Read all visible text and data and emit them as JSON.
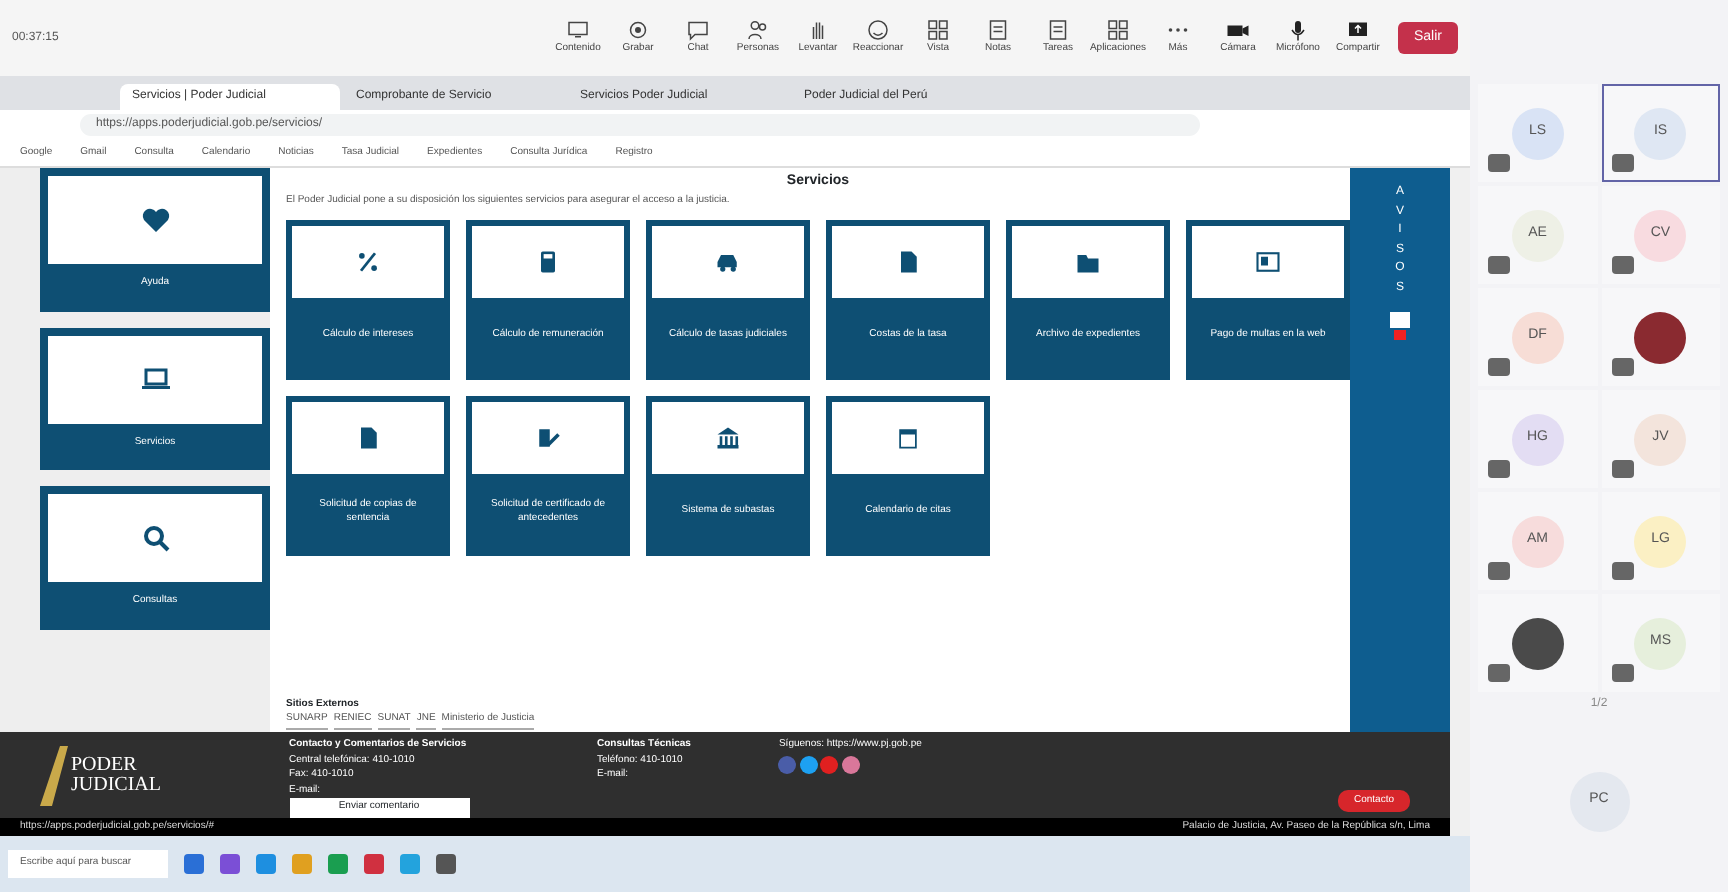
{
  "meeting_bar": {
    "timer": "00:37:15",
    "tools": [
      {
        "label": "Contenido"
      },
      {
        "label": "Grabar"
      },
      {
        "label": "Chat"
      },
      {
        "label": "Personas"
      },
      {
        "label": "Levantar"
      },
      {
        "label": "Reaccionar"
      },
      {
        "label": "Vista"
      },
      {
        "label": "Notas"
      },
      {
        "label": "Tareas"
      },
      {
        "label": "Aplicaciones"
      },
      {
        "label": "Más"
      },
      {
        "label": "Cámara"
      },
      {
        "label": "Micrófono"
      },
      {
        "label": "Compartir"
      }
    ],
    "leave_button": "Salir"
  },
  "browser": {
    "tabs": [
      {
        "title": "Servicios | Poder Judicial",
        "selected": true
      },
      {
        "title": "Comprobante de Servicio",
        "selected": false
      },
      {
        "title": "Servicios Poder Judicial",
        "selected": false
      },
      {
        "title": "Poder Judicial del Perú",
        "selected": false
      }
    ],
    "address": "https://apps.poderjudicial.gob.pe/servicios/",
    "bookmarks": [
      "Google",
      "Gmail",
      "Consulta",
      "Calendario",
      "Noticias",
      "Tasa Judicial",
      "Expedientes",
      "Consulta Jurídica",
      "Registro"
    ]
  },
  "sidebar": [
    {
      "label": "Ayuda"
    },
    {
      "label": "Servicios"
    },
    {
      "label": "Consultas"
    }
  ],
  "main": {
    "title": "Servicios",
    "description": "El Poder Judicial pone a su disposición los siguientes servicios para asegurar el acceso a la justicia.",
    "cards": [
      {
        "label": "Cálculo de intereses"
      },
      {
        "label": "Cálculo de remuneración"
      },
      {
        "label": "Cálculo de tasas judiciales"
      },
      {
        "label": "Costas de la tasa"
      },
      {
        "label": "Archivo de expedientes"
      },
      {
        "label": "Pago de multas en la web"
      },
      {
        "label": "Solicitud de copias de sentencia"
      },
      {
        "label": "Solicitud de certificado de antecedentes"
      },
      {
        "label": "Sistema de subastas"
      },
      {
        "label": "Calendario de citas"
      }
    ],
    "external_title": "Sitios Externos",
    "external_links": [
      "SUNARP",
      "RENIEC",
      "SUNAT",
      "JNE",
      "Ministerio de Justicia"
    ]
  },
  "side_rail": {
    "label": "AVISOS"
  },
  "footer": {
    "logo_line_1": "PODER",
    "logo_line_2": "JUDICIAL",
    "contact_title": "Contacto y Comentarios de Servicios",
    "contact_lines": [
      "Central telefónica: 410-1010",
      "Fax: 410-1010",
      "E-mail:"
    ],
    "contact_button": "Enviar comentario",
    "tech_title": "Consultas Técnicas",
    "tech_lines": [
      "Teléfono: 410-1010",
      "E-mail:"
    ],
    "follow": "Síguenos: https://www.pj.gob.pe",
    "address_line": "Palacio de Justicia, Av. Paseo de la República s/n, Lima",
    "chat_button": "Contacto"
  },
  "status_url": "https://apps.poderjudicial.gob.pe/servicios/#",
  "taskbar": {
    "search": "Escribe aquí para buscar"
  },
  "participants": {
    "tiles": [
      {
        "kind": "initials",
        "initials": "LS",
        "color": "#d9e3f5",
        "selected": false
      },
      {
        "kind": "initials",
        "initials": "IS",
        "color": "#dfe7f3",
        "selected": true
      },
      {
        "kind": "initials",
        "initials": "AE",
        "color": "#eef0e6",
        "selected": false
      },
      {
        "kind": "initials",
        "initials": "CV",
        "color": "#f8dbe0",
        "selected": false
      },
      {
        "kind": "initials",
        "initials": "DF",
        "color": "#f7ddd6",
        "selected": false
      },
      {
        "kind": "photo",
        "color": "#8a2a30",
        "selected": false
      },
      {
        "kind": "initials",
        "initials": "HG",
        "color": "#e3ddf3",
        "selected": false
      },
      {
        "kind": "initials",
        "initials": "JV",
        "color": "#f3e4dc",
        "selected": false
      },
      {
        "kind": "initials",
        "initials": "AM",
        "color": "#f7dcdc",
        "selected": false
      },
      {
        "kind": "initials",
        "initials": "LG",
        "color": "#fbf0c4",
        "selected": false
      },
      {
        "kind": "photo",
        "color": "#4a4a4a",
        "selected": false
      },
      {
        "kind": "initials",
        "initials": "MS",
        "color": "#e6efdc",
        "selected": false
      }
    ],
    "pager": "1/2",
    "self": "PC"
  }
}
